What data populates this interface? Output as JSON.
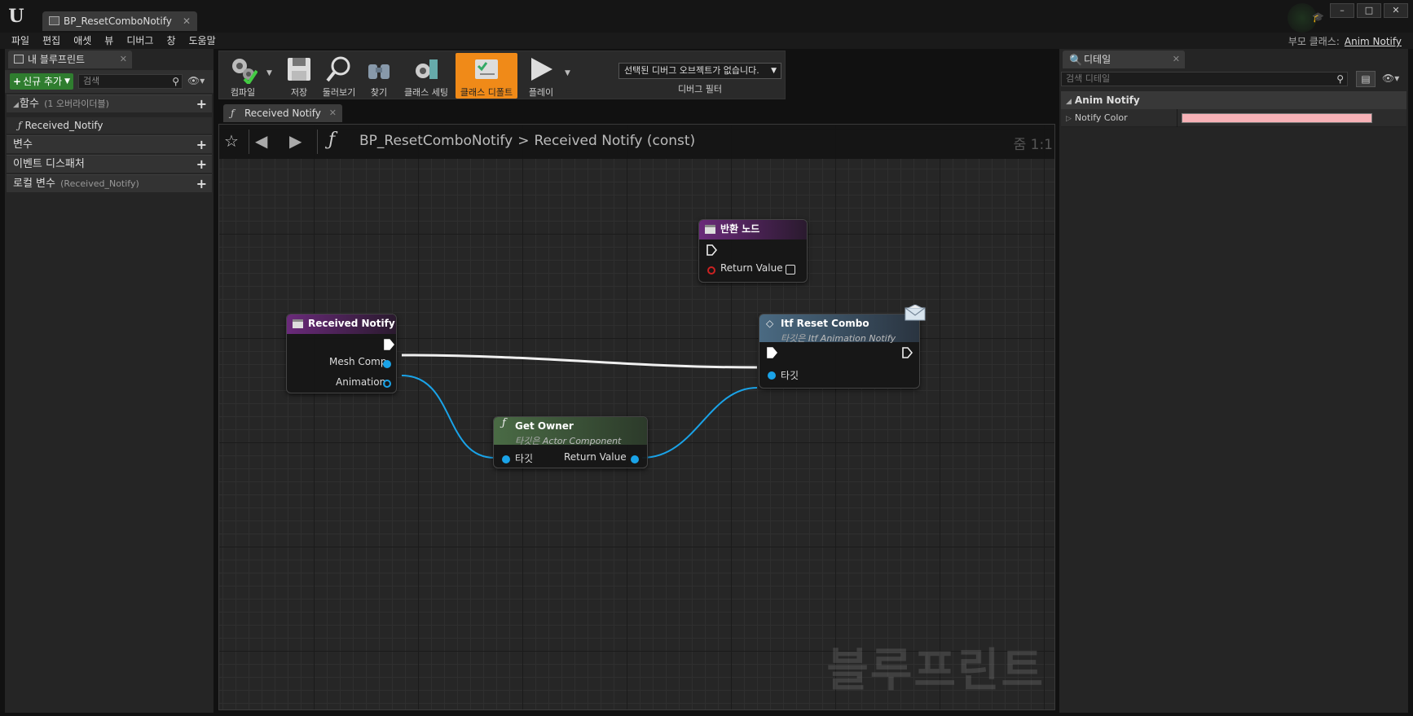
{
  "window": {
    "tab_title": "BP_ResetComboNotify",
    "minimize": "–",
    "maximize": "□",
    "close": "✕"
  },
  "menu": [
    "파일",
    "편집",
    "애셋",
    "뷰",
    "디버그",
    "창",
    "도움말"
  ],
  "parent_class": {
    "label": "부모 클래스:",
    "value": "Anim Notify"
  },
  "my_blueprint": {
    "tab_label": "내 블루프린트",
    "add_new_label": "신규 추가",
    "search_placeholder": "검색",
    "sections": {
      "functions": {
        "label": "함수",
        "sub": "(1 오버라이더블)"
      },
      "function_item": "Received_Notify",
      "variables": {
        "label": "변수"
      },
      "dispatchers": {
        "label": "이벤트 디스패처"
      },
      "local_vars": {
        "label": "로컬 변수",
        "sub": "(Received_Notify)"
      }
    }
  },
  "toolbar": {
    "compile": "컴파일",
    "save": "저장",
    "browse": "둘러보기",
    "find": "찾기",
    "class_settings": "클래스 세팅",
    "class_defaults": "클래스 디폴트",
    "play": "플레이",
    "debug_object": "선택된 디버그 오브젝트가 없습니다.",
    "debug_filter": "디버그 필터"
  },
  "graph": {
    "tab_label": "Received Notify",
    "breadcrumb_root": "BP_ResetComboNotify",
    "breadcrumb_sep": ">",
    "breadcrumb_func": "Received Notify (const)",
    "zoom": "줌 1:1",
    "watermark": "블루프린트",
    "nodes": {
      "return_node": {
        "title": "반환 노드",
        "pin": "Return Value"
      },
      "received_notify": {
        "title": "Received Notify",
        "pin_mesh": "Mesh Comp",
        "pin_anim": "Animation"
      },
      "get_owner": {
        "title": "Get Owner",
        "sub_prefix": "타깃은",
        "sub_class": "Actor Component",
        "pin_target": "타깃",
        "pin_return": "Return Value"
      },
      "itf_reset_combo": {
        "title": "Itf Reset Combo",
        "sub_prefix": "타깃은",
        "sub_class": "Itf Animation Notify",
        "pin_target": "타깃"
      }
    }
  },
  "details": {
    "tab_label": "디테일",
    "search_placeholder": "검색 디테일",
    "section": "Anim Notify",
    "row_label": "Notify Color",
    "notify_color": "#f7b2b7"
  },
  "colors": {
    "accent_orange": "#f08a18",
    "function_purple": "#6a2a7a",
    "get_owner_green": "#4a6b45",
    "interface_blue": "#4a6a82",
    "object_pin_blue": "#1aa3e8",
    "add_new_green": "#2f7d2f"
  }
}
